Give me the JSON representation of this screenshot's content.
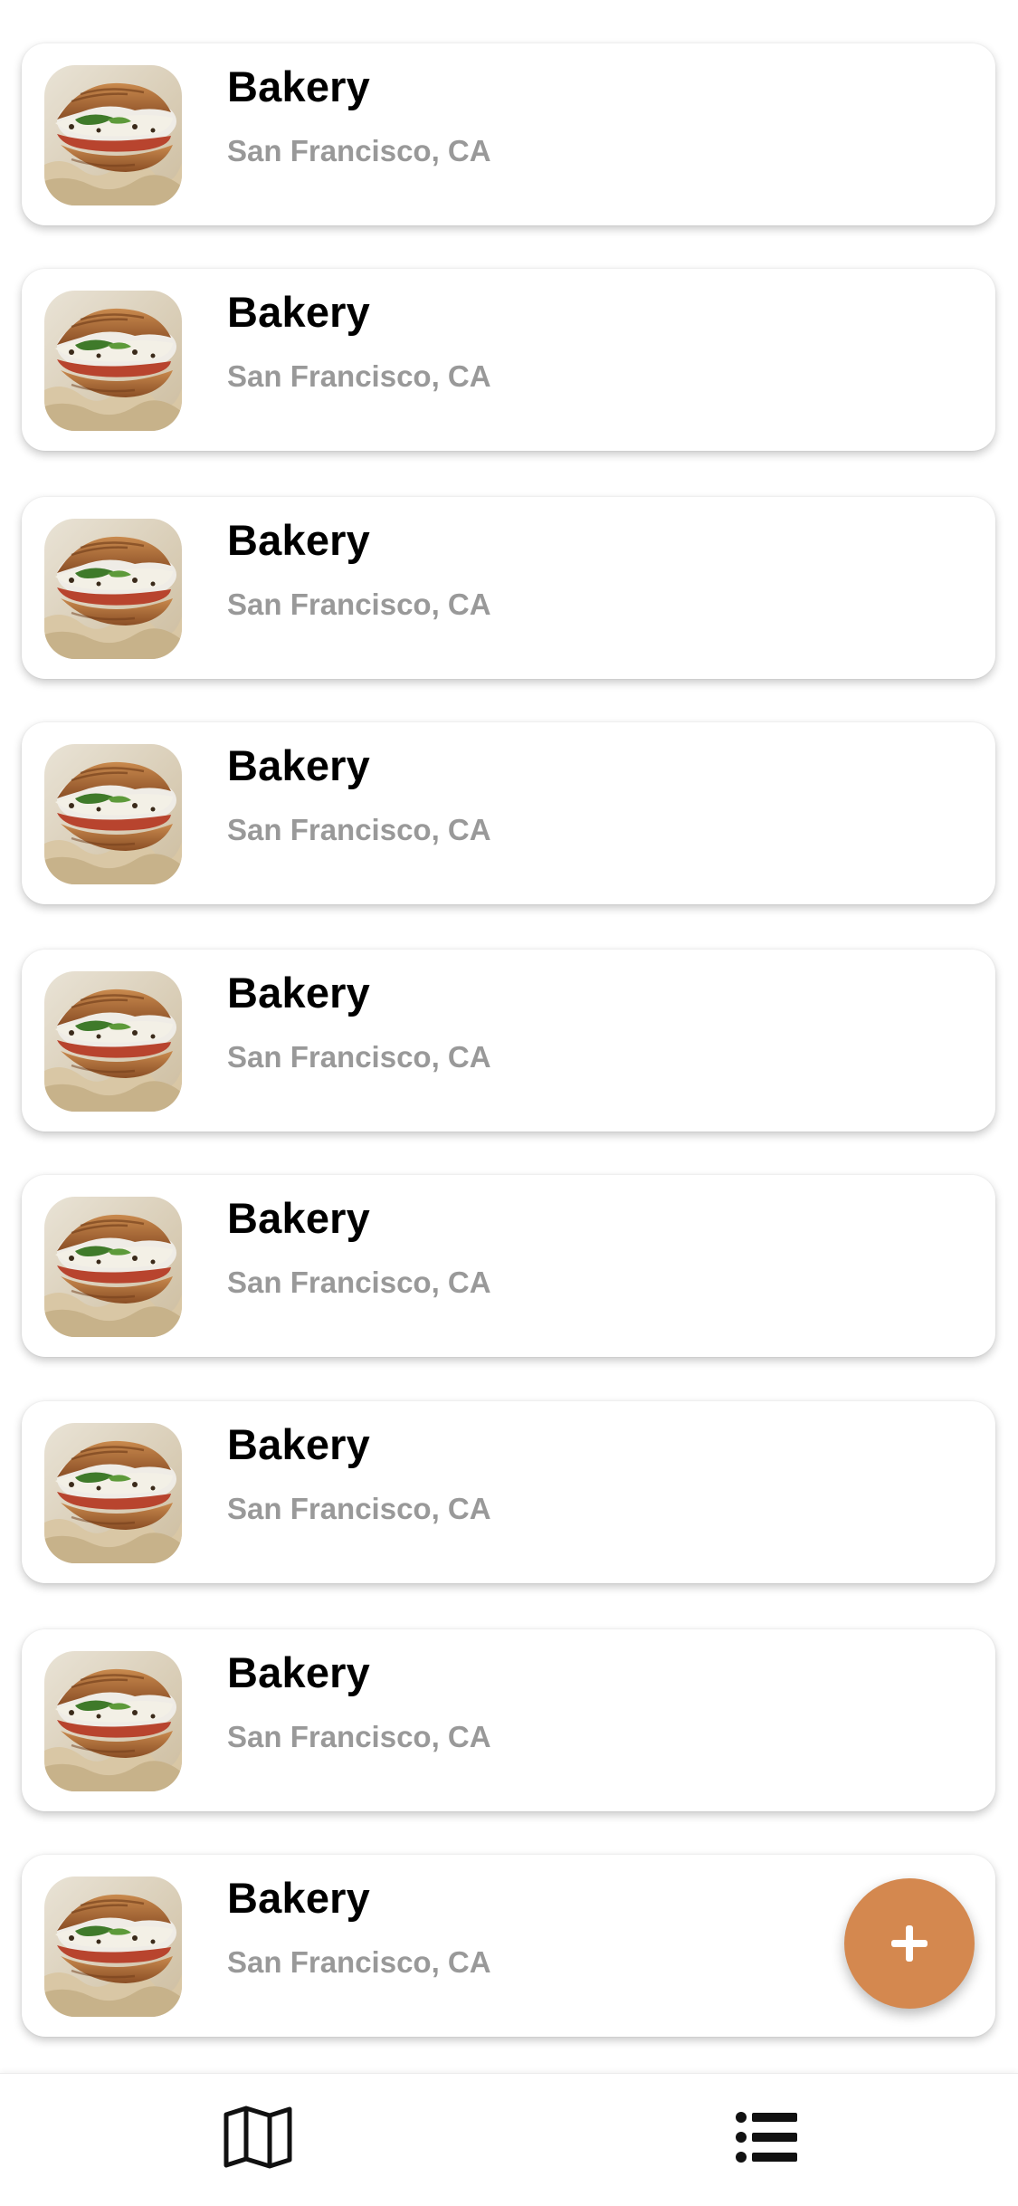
{
  "places": [
    {
      "name": "Bakery",
      "location": "San Francisco, CA"
    },
    {
      "name": "Bakery",
      "location": "San Francisco, CA"
    },
    {
      "name": "Bakery",
      "location": "San Francisco, CA"
    },
    {
      "name": "Bakery",
      "location": "San Francisco, CA"
    },
    {
      "name": "Bakery",
      "location": "San Francisco, CA"
    },
    {
      "name": "Bakery",
      "location": "San Francisco, CA"
    },
    {
      "name": "Bakery",
      "location": "San Francisco, CA"
    },
    {
      "name": "Bakery",
      "location": "San Francisco, CA"
    },
    {
      "name": "Bakery",
      "location": "San Francisco, CA"
    }
  ],
  "fab": {
    "icon": "plus-icon",
    "color": "#d4884f"
  },
  "tabbar": {
    "tabs": [
      {
        "icon": "map-icon"
      },
      {
        "icon": "list-icon"
      }
    ]
  },
  "colors": {
    "title": "#000000",
    "subtitle": "#999999",
    "accent": "#d4884f"
  }
}
